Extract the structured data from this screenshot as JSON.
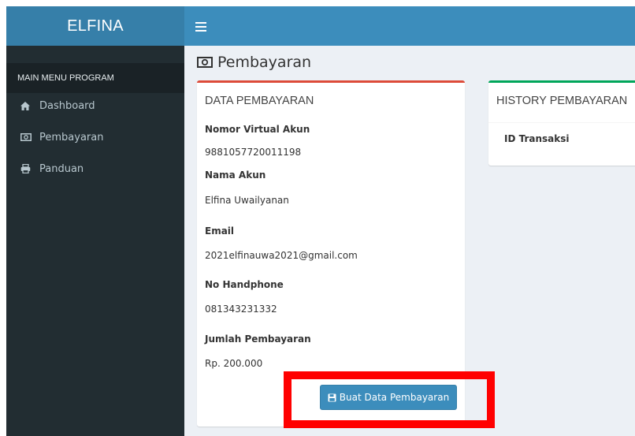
{
  "header": {
    "logo": "ELFINA",
    "menu_toggle_icon": "hamburger-icon",
    "colors": {
      "logo_bg": "#367fa9",
      "bar_bg": "#3c8dbc"
    }
  },
  "sidebar": {
    "section_header": "MAIN MENU PROGRAM",
    "items": [
      {
        "label": "Dashboard",
        "icon": "home-icon"
      },
      {
        "label": "Pembayaran",
        "icon": "money-icon"
      },
      {
        "label": "Panduan",
        "icon": "print-icon"
      }
    ],
    "colors": {
      "bg": "#222d32",
      "header_bg": "#1a2226",
      "text": "#b8c7ce"
    }
  },
  "page": {
    "title": "Pembayaran",
    "title_icon": "money-icon"
  },
  "data_box": {
    "title": "DATA PEMBAYARAN",
    "fields": [
      {
        "label": "Nomor Virtual Akun",
        "value": "9881057720011198"
      },
      {
        "label": "Nama Akun",
        "value": "Elfina Uwailyanan"
      },
      {
        "label": "Email",
        "value": "2021elfinauwa2021@gmail.com"
      },
      {
        "label": "No Handphone",
        "value": "081343231332"
      },
      {
        "label": "Jumlah Pembayaran",
        "value": "Rp. 200.000"
      }
    ],
    "button_label": "Buat Data Pembayaran",
    "button_icon": "save-icon",
    "accent_color": "#dd4b39"
  },
  "history_box": {
    "title": "HISTORY PEMBAYARAN",
    "column_header": "ID Transaksi",
    "accent_color": "#00a65a"
  },
  "annotation": {
    "highlight_color": "#ff0000"
  }
}
